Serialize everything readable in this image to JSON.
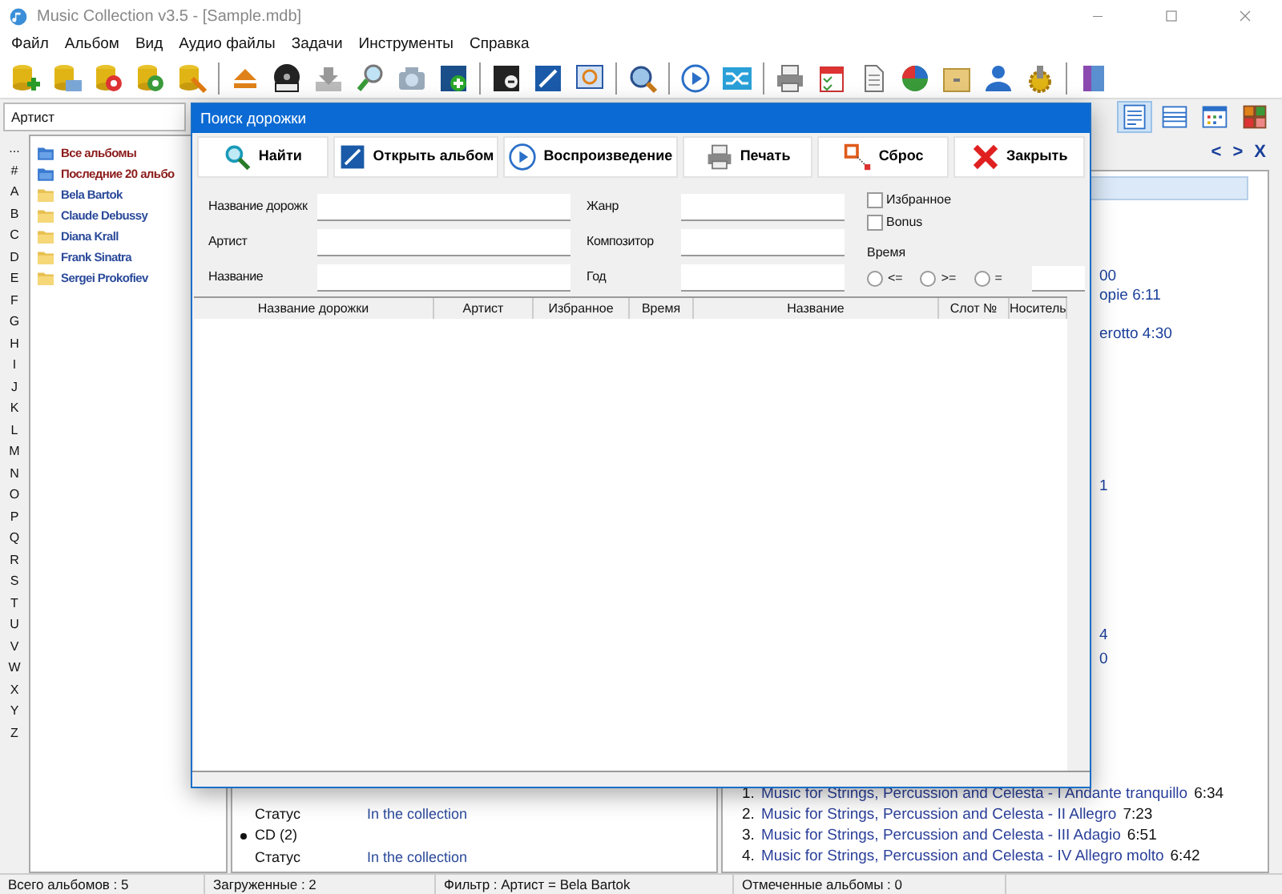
{
  "window": {
    "title": "Music Collection v3.5 - [Sample.mdb]"
  },
  "menu": [
    "Файл",
    "Альбом",
    "Вид",
    "Аудио файлы",
    "Задачи",
    "Инструменты",
    "Справка"
  ],
  "filter_combo": {
    "value": "Артист"
  },
  "view_buttons": [
    {
      "selected": true
    },
    {
      "selected": false
    },
    {
      "selected": false
    },
    {
      "selected": false
    }
  ],
  "alphabet": [
    "...",
    "#",
    "A",
    "B",
    "C",
    "D",
    "E",
    "F",
    "G",
    "H",
    "I",
    "J",
    "K",
    "L",
    "M",
    "N",
    "O",
    "P",
    "Q",
    "R",
    "S",
    "T",
    "U",
    "V",
    "W",
    "X",
    "Y",
    "Z"
  ],
  "tree": [
    {
      "kind": "special",
      "label": "Все альбомы"
    },
    {
      "kind": "special",
      "label": "Последние 20 альбо"
    },
    {
      "kind": "artist",
      "label": "Bela Bartok"
    },
    {
      "kind": "artist",
      "label": "Claude Debussy"
    },
    {
      "kind": "artist",
      "label": "Diana Krall"
    },
    {
      "kind": "artist",
      "label": "Frank Sinatra"
    },
    {
      "kind": "artist",
      "label": "Sergei Prokofiev"
    }
  ],
  "details": [
    {
      "kind": "field",
      "label": "Статус",
      "value": "In the collection"
    },
    {
      "kind": "bullet",
      "label": "CD (2)"
    },
    {
      "kind": "field",
      "label": "Статус",
      "value": "In the collection"
    }
  ],
  "right_panel": {
    "nav": [
      "<",
      ">",
      "X"
    ],
    "fragments": [
      "00",
      "opie 6:11",
      "erotto 4:30",
      "1",
      "4",
      "0"
    ],
    "tracks": [
      {
        "number": "1.",
        "title": "Music for Strings, Percussion and Celesta - I Andante tranquillo",
        "duration": "6:34"
      },
      {
        "number": "2.",
        "title": "Music for Strings, Percussion and Celesta - II Allegro",
        "duration": "7:23"
      },
      {
        "number": "3.",
        "title": "Music for Strings, Percussion and Celesta - III Adagio",
        "duration": "6:51"
      },
      {
        "number": "4.",
        "title": "Music for Strings, Percussion and Celesta - IV Allegro molto",
        "duration": "6:42"
      }
    ]
  },
  "dialog": {
    "title": "Поиск дорожки",
    "buttons": [
      {
        "kind": "search",
        "label": "Найти"
      },
      {
        "kind": "edit",
        "label": "Открыть альбом"
      },
      {
        "kind": "play",
        "label": "Воспроизведение"
      },
      {
        "kind": "print",
        "label": "Печать"
      },
      {
        "kind": "reset",
        "label": "Сброс"
      },
      {
        "kind": "close",
        "label": "Закрыть"
      }
    ],
    "fields_left": [
      "Название дорожк",
      "Артист",
      "Название"
    ],
    "fields_right": [
      "Жанр",
      "Композитор",
      "Год"
    ],
    "checkboxes": [
      {
        "label": "Избранное",
        "checked": false
      },
      {
        "label": "Bonus",
        "checked": false
      }
    ],
    "time": {
      "label": "Время",
      "options": [
        {
          "label": "<=",
          "selected": false
        },
        {
          "label": ">=",
          "selected": false
        },
        {
          "label": "=",
          "selected": false
        }
      ]
    },
    "columns": [
      "Название дорожки",
      "Артист",
      "Избранное",
      "Время",
      "Название",
      "Слот №",
      "Носитель"
    ]
  },
  "status_bar": [
    "Всего альбомов : 5",
    "Загруженные : 2",
    "Фильтр : Артист = Bela Bartok",
    "Отмеченные альбомы : 0"
  ]
}
